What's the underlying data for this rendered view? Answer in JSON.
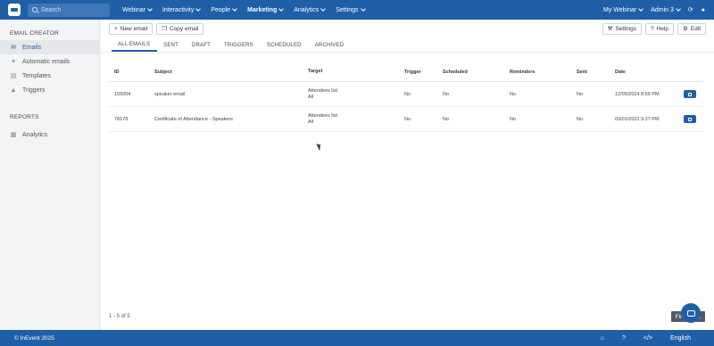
{
  "topbar": {
    "search_placeholder": "Search",
    "nav": [
      {
        "label": "Webinar"
      },
      {
        "label": "Interactivity"
      },
      {
        "label": "People"
      },
      {
        "label": "Marketing"
      },
      {
        "label": "Analytics"
      },
      {
        "label": "Settings"
      }
    ],
    "event_name": "My Webinar",
    "user": "Admin 3"
  },
  "sidebar": {
    "section1": "EMAIL CREATOR",
    "items1": [
      {
        "label": "Emails",
        "icon": "envelope-icon"
      },
      {
        "label": "Automatic emails",
        "icon": "wand-icon"
      },
      {
        "label": "Templates",
        "icon": "file-icon"
      },
      {
        "label": "Triggers",
        "icon": "trigger-icon"
      }
    ],
    "section2": "REPORTS",
    "items2": [
      {
        "label": "Analytics",
        "icon": "chart-icon"
      }
    ]
  },
  "toolbar": {
    "new_email": "New email",
    "copy_email": "Copy email",
    "settings": "Settings",
    "help": "Help",
    "edit": "Edit"
  },
  "tabs": [
    "ALL EMAILS",
    "SENT",
    "DRAFT",
    "TRIGGERS",
    "SCHEDULED",
    "ARCHIVED"
  ],
  "table": {
    "headers": {
      "id": "ID",
      "subject": "Subject",
      "target": "Target",
      "trigger": "Trigger",
      "scheduled": "Scheduled",
      "reminders": "Reminders",
      "sent": "Sent",
      "date": "Date"
    },
    "rows": [
      {
        "id": "155004",
        "subject": "speaker email",
        "target1": "Attendees list",
        "target2": "All",
        "trigger": "No",
        "scheduled": "No",
        "reminders": "No",
        "sent": "No",
        "date": "12/05/2024 8:56 PM"
      },
      {
        "id": "78178",
        "subject": "Certificate of Attendance - Speakers",
        "target1": "Attendees list",
        "target2": "All",
        "trigger": "No",
        "scheduled": "No",
        "reminders": "No",
        "sent": "No",
        "date": "03/01/2022 9:27 PM"
      }
    ]
  },
  "footer": {
    "count": "1 - 5 of 5",
    "first": "First",
    "page": "1"
  },
  "bottombar": {
    "copyright": "© InEvent 2025",
    "language": "English"
  }
}
